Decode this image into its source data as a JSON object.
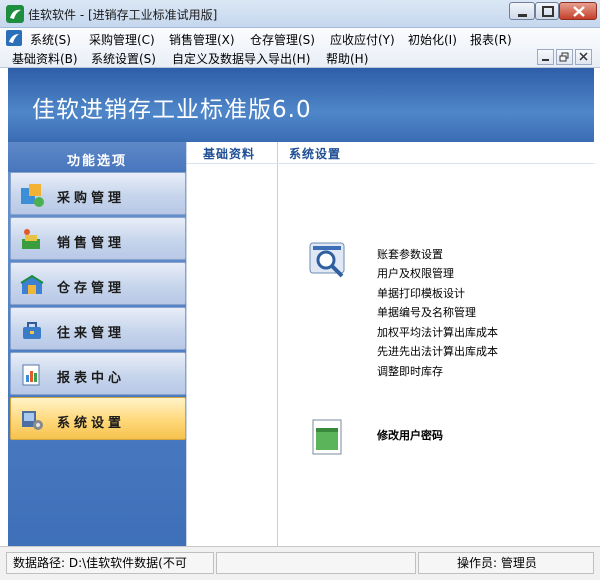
{
  "window": {
    "title": "佳软软件 - [进销存工业标准试用版]"
  },
  "menu": {
    "row1": [
      "系统(S)",
      "采购管理(C)",
      "销售管理(X)",
      "仓存管理(S)",
      "应收应付(Y)",
      "初始化(I)",
      "报表(R)"
    ],
    "row2": [
      "基础资料(B)",
      "系统设置(S)",
      "自定义及数据导入导出(H)",
      "帮助(H)"
    ]
  },
  "banner": {
    "title": "佳软进销存工业标准版6.0"
  },
  "sidebar": {
    "header": "功能选项",
    "items": [
      {
        "label": "采购管理",
        "icon": "purchase-icon"
      },
      {
        "label": "销售管理",
        "icon": "sales-icon"
      },
      {
        "label": "仓存管理",
        "icon": "warehouse-icon"
      },
      {
        "label": "往来管理",
        "icon": "contacts-icon"
      },
      {
        "label": "报表中心",
        "icon": "report-icon"
      },
      {
        "label": "系统设置",
        "icon": "settings-icon",
        "active": true
      }
    ]
  },
  "content": {
    "tabs": [
      "基础资料",
      "系统设置"
    ],
    "settings_links": [
      "账套参数设置",
      "用户及权限管理",
      "单据打印模板设计",
      "单据编号及名称管理",
      "加权平均法计算出库成本",
      "先进先出法计算出库成本",
      "调整即时库存"
    ],
    "password_link": "修改用户密码"
  },
  "status": {
    "path": "数据路径: D:\\佳软软件数据(不可",
    "operator": "操作员: 管理员"
  },
  "colors": {
    "banner": "#3f74bd",
    "sidebar": "#4f7fc4",
    "active_item": "#ffd87a",
    "tab_text": "#1f4f95"
  }
}
